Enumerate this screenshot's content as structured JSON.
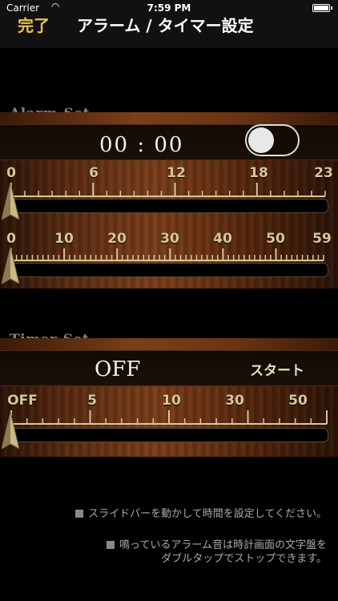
{
  "statusbar": {
    "carrier": "Carrier",
    "time": "7:59 PM"
  },
  "navbar": {
    "done_label": "完了",
    "title": "アラーム / タイマー設定"
  },
  "alarm": {
    "section_label": "Alarm-Set",
    "time_text": "00  :  00",
    "toggle_on": false,
    "hour_scale": {
      "labels": [
        "0",
        "6",
        "12",
        "18",
        "23"
      ],
      "value": 0
    },
    "minute_scale": {
      "labels": [
        "0",
        "10",
        "20",
        "30",
        "40",
        "50",
        "59"
      ],
      "value": 0
    }
  },
  "timer": {
    "section_label": "Timer-Set",
    "status_text": "OFF",
    "start_label": "スタート",
    "scale": {
      "labels": [
        "OFF",
        "5",
        "10",
        "30",
        "50"
      ],
      "value": 0
    }
  },
  "notes": {
    "note1": "スライドバーを動かして時間を設定してください。",
    "note2_line1": "鳴っているアラーム音は時計画面の文字盤を",
    "note2_line2": "ダブルタップでストップできます。"
  },
  "colors": {
    "accent": "#e8c34d",
    "scale_text": "#d6c79a",
    "background": "#000000"
  }
}
